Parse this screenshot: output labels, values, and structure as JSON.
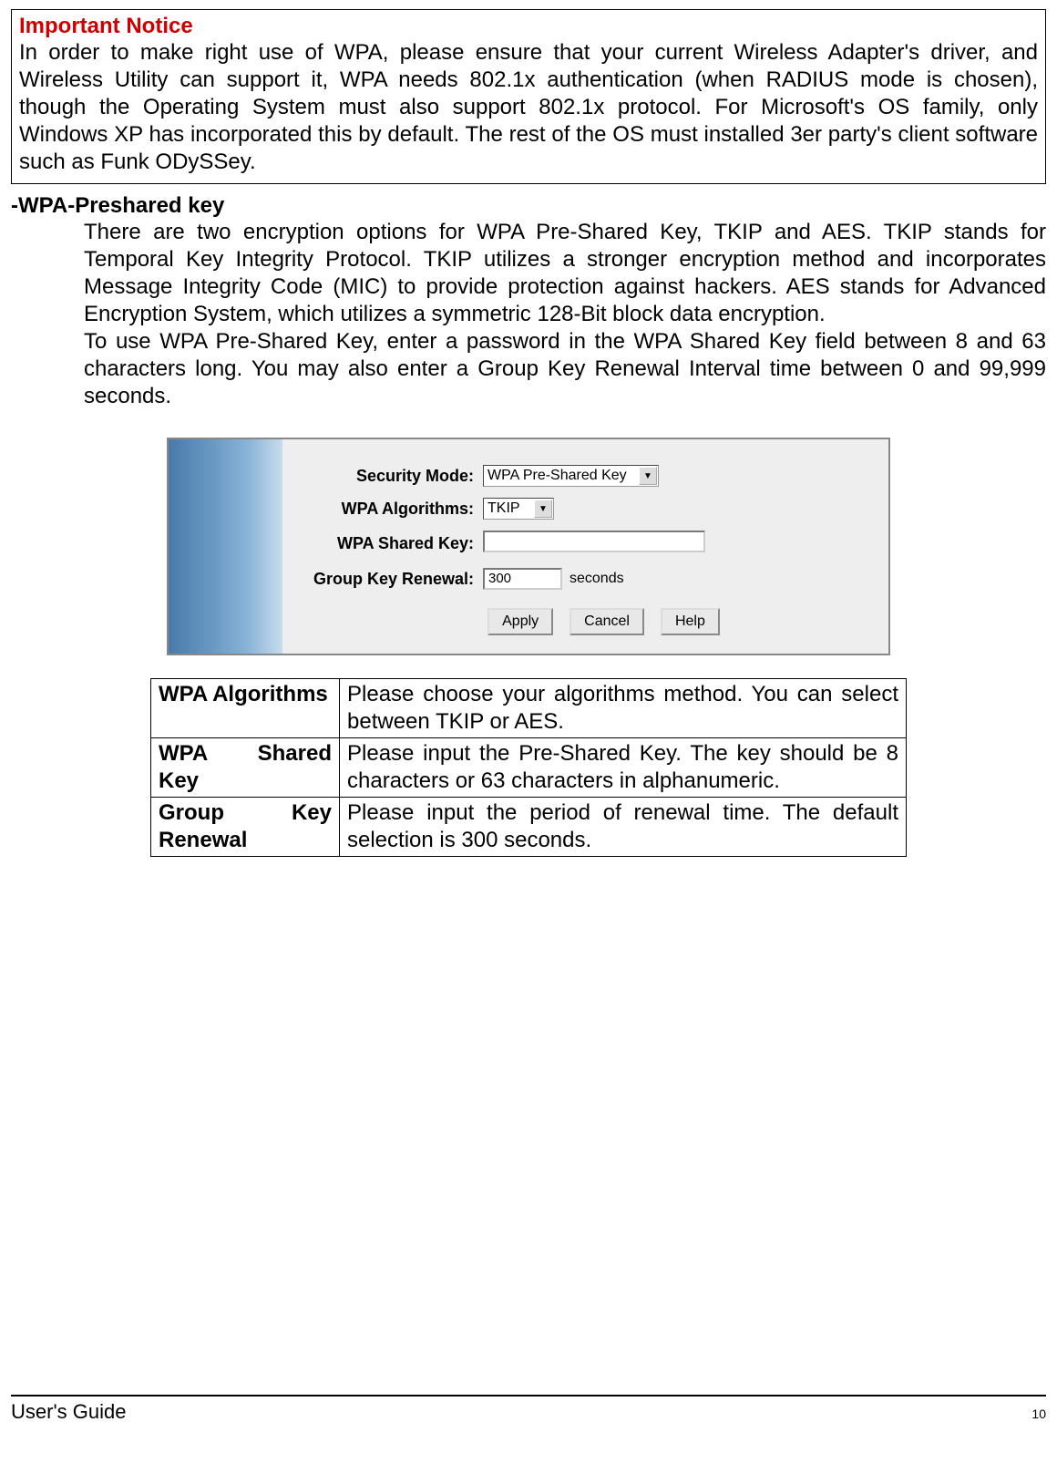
{
  "notice": {
    "title": "Important Notice",
    "body": "In order to make right use of WPA, please ensure that your current Wireless Adapter's driver, and Wireless Utility can support it, WPA needs 802.1x authentication (when RADIUS mode is chosen), though the Operating System must also support 802.1x protocol. For Microsoft's OS family, only Windows XP has incorporated this by default. The rest of the OS must installed 3er party's client software such as Funk ODySSey."
  },
  "section": {
    "heading": "-WPA-Preshared key",
    "p1": "There are two encryption options for WPA Pre-Shared Key, TKIP and AES. TKIP stands for Temporal Key Integrity Protocol. TKIP utilizes a stronger encryption method and incorporates Message Integrity Code (MIC) to provide protection against hackers. AES stands for Advanced Encryption System, which utilizes a symmetric 128-Bit block data encryption.",
    "p2": "To use WPA Pre-Shared Key, enter a password in the WPA Shared Key field between 8 and 63 characters long. You may also enter a Group Key Renewal Interval time between 0 and 99,999 seconds."
  },
  "form": {
    "security_mode_label": "Security Mode:",
    "security_mode_value": "WPA Pre-Shared Key",
    "wpa_algorithms_label": "WPA Algorithms:",
    "wpa_algorithms_value": "TKIP",
    "wpa_shared_key_label": "WPA Shared Key:",
    "wpa_shared_key_value": "",
    "group_key_renewal_label": "Group Key Renewal:",
    "group_key_renewal_value": "300",
    "group_key_renewal_suffix": "seconds",
    "apply_btn": "Apply",
    "cancel_btn": "Cancel",
    "help_btn": "Help"
  },
  "descriptions": {
    "rows": [
      {
        "term": "WPA Algorithms",
        "def": "Please choose your algorithms method. You can select between TKIP or AES."
      },
      {
        "term": "WPA Shared Key",
        "def": "Please input the Pre-Shared Key. The key should be 8 characters or 63 characters in alphanumeric."
      },
      {
        "term_a": "Group",
        "term_b": "Key",
        "term_c": "Renewal",
        "def": "Please input the period of renewal time. The default selection is 300 seconds."
      }
    ]
  },
  "footer": {
    "text": "User's Guide",
    "page": "10"
  }
}
